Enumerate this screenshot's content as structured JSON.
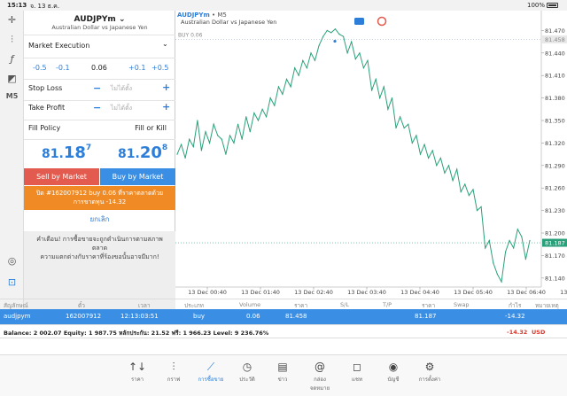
{
  "status": {
    "time": "15:13",
    "date": "จ. 13 ธ.ค.",
    "battery": "100%"
  },
  "sidebar": {
    "items": [
      {
        "icon": "crosshair-icon"
      },
      {
        "icon": "candles-icon"
      },
      {
        "icon": "function-icon"
      },
      {
        "icon": "objects-icon"
      },
      {
        "label": "M5"
      },
      {
        "icon": "chat-icon"
      },
      {
        "icon": "save-icon"
      }
    ]
  },
  "symbol": {
    "name": "AUDJPYm",
    "description": "Australian Dollar vs Japanese Yen"
  },
  "execution": {
    "label": "Market Execution"
  },
  "volume": {
    "m05": "-0.5",
    "m01": "-0.1",
    "value": "0.06",
    "p01": "+0.1",
    "p05": "+0.5"
  },
  "stop_loss": {
    "label": "Stop Loss",
    "value": "ไม่ได้ตั้ง",
    "minus": "−",
    "plus": "+"
  },
  "take_profit": {
    "label": "Take Profit",
    "value": "ไม่ได้ตั้ง",
    "minus": "−",
    "plus": "+"
  },
  "fill_policy": {
    "label": "Fill Policy",
    "value": "Fill or Kill"
  },
  "prices": {
    "bid_main": "81.",
    "bid_big": "18",
    "bid_sup": "7",
    "ask_main": "81.",
    "ask_big": "20",
    "ask_sup": "8"
  },
  "buttons": {
    "sell": "Sell by Market",
    "buy": "Buy by Market",
    "close_line1": "ปิด #162007912 buy 0.06 ที่ราคาตลาดด้วย",
    "close_line2": "การขาดทุน -14.32",
    "cancel": "ยกเลิก"
  },
  "warning": {
    "line1": "คำเตือน! การซื้อขายจะถูกดำเนินการตามสภาพตลาด",
    "line2": "ความแตกต่างกับราคาที่ร้องขอนั้นอาจมีมาก!"
  },
  "chart": {
    "title": "AUDJPYm",
    "timeframe": "• M5",
    "description": "Australian Dollar vs Japanese Yen",
    "buy_label": "BUY 0.06",
    "buy_price_tag": "81.458",
    "bid_price_tag": "81.187",
    "line_color": "#2aa07a"
  },
  "chart_data": {
    "type": "line",
    "y_ticks": [
      "81.470",
      "81.440",
      "81.410",
      "81.380",
      "81.350",
      "81.320",
      "81.290",
      "81.260",
      "81.230",
      "81.200",
      "81.170",
      "81.140"
    ],
    "y_tick_values": [
      81.47,
      81.44,
      81.41,
      81.38,
      81.35,
      81.32,
      81.29,
      81.26,
      81.23,
      81.2,
      81.17,
      81.14
    ],
    "x_ticks": [
      "13 Dec 00:40",
      "13 Dec 01:40",
      "13 Dec 02:40",
      "13 Dec 03:40",
      "13 Dec 04:40",
      "13 Dec 05:40",
      "13 Dec 06:40",
      "13 Dec 07:40"
    ],
    "ylim": [
      81.128,
      81.487
    ],
    "buy_level": 81.458,
    "bid_level": 81.187,
    "values": [
      81.305,
      81.318,
      81.3,
      81.325,
      81.315,
      81.35,
      81.31,
      81.335,
      81.32,
      81.345,
      81.33,
      81.325,
      81.305,
      81.33,
      81.32,
      81.345,
      81.325,
      81.355,
      81.335,
      81.36,
      81.35,
      81.365,
      81.355,
      81.38,
      81.37,
      81.395,
      81.385,
      81.405,
      81.395,
      81.42,
      81.41,
      81.43,
      81.42,
      81.44,
      81.43,
      81.45,
      81.462,
      81.47,
      81.467,
      81.472,
      81.465,
      81.462,
      81.44,
      81.455,
      81.432,
      81.44,
      81.42,
      81.43,
      81.39,
      81.405,
      81.38,
      81.395,
      81.365,
      81.38,
      81.34,
      81.355,
      81.34,
      81.345,
      81.32,
      81.33,
      81.305,
      81.318,
      81.3,
      81.31,
      81.29,
      81.3,
      81.28,
      81.29,
      81.27,
      81.285,
      81.255,
      81.265,
      81.25,
      81.258,
      81.23,
      81.235,
      81.18,
      81.19,
      81.16,
      81.145,
      81.135,
      81.175,
      81.19,
      81.18,
      81.205,
      81.195,
      81.165,
      81.19
    ]
  },
  "order_tabs": [
    "สัญลักษณ์",
    "ตั๋ว",
    "เวลา",
    "ประเภท",
    "Volume",
    "ราคา",
    "S/L",
    "T/P",
    "ราคา",
    "Swap",
    "กำไร",
    "หมายเหตุ"
  ],
  "position": {
    "symbol": "audjpym",
    "ticket": "162007912",
    "time": "12:13:03:51",
    "type": "buy",
    "volume": "0.06",
    "open_price": "81.458",
    "sl": "",
    "tp": "",
    "price": "81.187",
    "swap": "",
    "profit": "-14.32",
    "comment": ""
  },
  "balance": {
    "text": "Balance: 2 002.07  Equity: 1 987.75  หลักประกัน: 21.52  ฟรี: 1 966.23  Level: 9 236.76%",
    "profit": "-14.32",
    "currency": "USD"
  },
  "bottom_nav": [
    {
      "label": "ราคา",
      "icon": "↑↓"
    },
    {
      "label": "กราฟ",
      "icon": "⫶"
    },
    {
      "label": "การซื้อขาย",
      "icon": "⟋"
    },
    {
      "label": "ประวัติ",
      "icon": "◷"
    },
    {
      "label": "ข่าว",
      "icon": "▤"
    },
    {
      "label": "กล่องจดหมาย",
      "icon": "@"
    },
    {
      "label": "แชท",
      "icon": "◻"
    },
    {
      "label": "บัญชี",
      "icon": "◉"
    },
    {
      "label": "การตั้งค่า",
      "icon": "⚙"
    }
  ]
}
